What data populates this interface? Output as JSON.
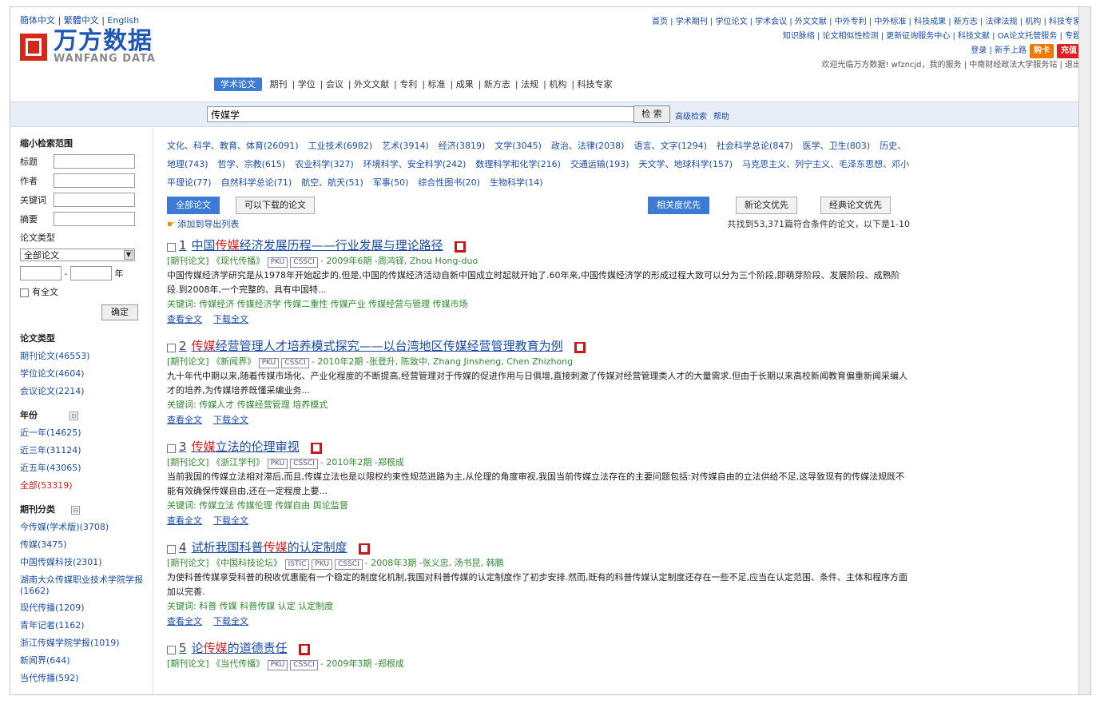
{
  "lang": [
    "簡体中文",
    "繁體中文",
    "English"
  ],
  "logo": {
    "cn": "万方数据",
    "en": "WANFANG DATA"
  },
  "toplinks": {
    "line1": "首页 | 学术期刊 | 学位论文 | 学术会议 | 外文文献 | 中外专利 | 中外标准 | 科技成果 | 新方志 | 法律法规 | 机构 | 科技专家",
    "line2": "知识脉络 | 论文相似性检测 | 更新征询服务中心 | 科技文献 | OA论文托管服务 | 专题",
    "line3": "登录 | 新手上路",
    "buy": "购卡",
    "recharge": "充值",
    "line4": "欢迎光临万方数据! wfzncjd，我的服务 | 中南财经政法大学服务站 | 退出"
  },
  "nav": {
    "active": "学术论文",
    "items": [
      "期刊",
      "学位",
      "会议",
      "外文文献",
      "专利",
      "标准",
      "成果",
      "新方志",
      "法规",
      "机构",
      "科技专家"
    ]
  },
  "search": {
    "value": "传媒学",
    "button": "检 索",
    "advanced": "高级检索",
    "help": "帮助"
  },
  "sidebar": {
    "narrow_title": "缩小检索范围",
    "fields": [
      "标题",
      "作者",
      "关键词",
      "摘要"
    ],
    "type_label": "论文类型",
    "type_select": "全部论文",
    "year_unit": "年",
    "fulltext": "有全文",
    "confirm": "确定",
    "type_head": "论文类型",
    "types": [
      "期刊论文(46553)",
      "学位论文(4604)",
      "会议论文(2214)"
    ],
    "year_head": "年份",
    "years": [
      "近一年(14625)",
      "近三年(31124)",
      "近五年(43065)",
      "全部(53319)"
    ],
    "journal_head": "期刊分类",
    "journals": [
      "今传媒(学术版)(3708)",
      "传媒(3475)",
      "中国传媒科技(2301)",
      "湖南大众传媒职业技术学院学报(1662)",
      "现代传播(1209)",
      "青年记者(1162)",
      "浙江传媒学院学报(1019)",
      "新闻界(644)",
      "当代传播(592)"
    ]
  },
  "categories": [
    "文化、科学、教育、体育(26091)",
    "工业技术(6982)",
    "艺术(3914)",
    "经济(3819)",
    "文学(3045)",
    "政治、法律(2038)",
    "语言、文字(1294)",
    "社会科学总论(847)",
    "医学、卫生(803)",
    "历史、地理(743)",
    "哲学、宗教(615)",
    "农业科学(327)",
    "环境科学、安全科学(242)",
    "数理科学和化学(216)",
    "交通运输(193)",
    "天文学、地球科学(157)",
    "马克思主义、列宁主义、毛泽东思想、邓小平理论(77)",
    "自然科学总论(71)",
    "航空、航天(51)",
    "军事(50)",
    "综合性图书(20)",
    "生物科学(14)"
  ],
  "tabs": {
    "all": "全部论文",
    "downloadable": "可以下载的论文",
    "relevance": "相关度优先",
    "newest": "新论文优先",
    "classic": "经典论文优先"
  },
  "export": "添加到导出列表",
  "found": "共找到53,371篇符合条件的论文，以下是1-10",
  "results": [
    {
      "num": "1",
      "t1": "中国",
      "hl": "传媒",
      "t2": "经济发展历程——行业发展与理论路径",
      "meta": "[期刊论文] 《现代传播》",
      "tags": [
        "PKU",
        "CSSCI"
      ],
      "meta2": "- 2009年6期 -周鸿铎, Zhou Hong-duo",
      "abs": "中国传媒经济学研究是从1978年开始起步的,但是,中国的传媒经济活动自新中国成立时起就开始了.60年来,中国传媒经济学的形成过程大致可以分为三个阶段,即萌芽阶段、发展阶段、成熟阶段.到2008年,一个完整的、具有中国特...",
      "kw": "关键词: 传媒经济 传媒经济学 传媒二重性 传媒产业 传媒经营与管理 传媒市场",
      "view": "查看全文",
      "download": "下载全文"
    },
    {
      "num": "2",
      "t1": "",
      "hl": "传媒",
      "t2": "经营管理人才培养模式探究——以台湾地区传媒经营管理教育为例",
      "meta": "[期刊论文] 《新闻界》",
      "tags": [
        "PKU",
        "CSSCI"
      ],
      "meta2": "- 2010年2期 -张登升, 陈致中, Zhang Jinsheng, Chen Zhizhong",
      "abs": "九十年代中期以来,随着传媒市场化、产业化程度的不断提高,经营管理对于传媒的促进作用与日俱增,直接刺激了传媒对经营管理类人才的大量需求.但由于长期以来高校新闻教育偏重新闻采编人才的培养,为传媒培养既懂采编业务...",
      "kw": "关键词: 传媒人才 传媒经营管理 培养模式",
      "view": "查看全文",
      "download": "下载全文"
    },
    {
      "num": "3",
      "t1": "",
      "hl": "传媒",
      "t2": "立法的伦理审视",
      "meta": "[期刊论文] 《浙江学刊》",
      "tags": [
        "PKU",
        "CSSCI"
      ],
      "meta2": "- 2010年2期 -郑根成",
      "abs": "当前我国的传媒立法相对滞后,而且,传媒立法也是以限权约束性规范进路为主,从伦理的角度审视,我国当前传媒立法存在的主要问题包括:对传媒自由的立法供给不足,这导致现有的传媒法规既不能有效确保传媒自由,还在一定程度上要...",
      "kw": "关键词: 传媒立法 传媒伦理 传媒自由 舆论监督",
      "view": "查看全文",
      "download": "下载全文"
    },
    {
      "num": "4",
      "t1": "试析我国科普",
      "hl": "传媒",
      "t2": "的认定制度",
      "meta": "[期刊论文] 《中国科技论坛》",
      "tags": [
        "ISTIC",
        "PKU",
        "CSSCI"
      ],
      "meta2": "- 2008年3期 -张义忠, 汤书昆, 韩鹏",
      "abs": "为使科普传媒享受科普的税收优惠能有一个稳定的制度化机制,我国对科普传媒的认定制度作了初步安排.然而,既有的科普传媒认定制度还存在一些不足,应当在认定范围、条件、主体和程序方面加以完善.",
      "kw": "关键词: 科普 传媒 科普传媒 认定 认定制度",
      "view": "查看全文",
      "download": "下载全文"
    },
    {
      "num": "5",
      "t1": "论",
      "hl": "传媒",
      "t2": "的道德责任",
      "meta": "[期刊论文] 《当代传播》",
      "tags": [
        "PKU",
        "CSSCI"
      ],
      "meta2": "- 2009年3期 -郑根成",
      "abs": "",
      "kw": "",
      "view": "",
      "download": ""
    }
  ]
}
